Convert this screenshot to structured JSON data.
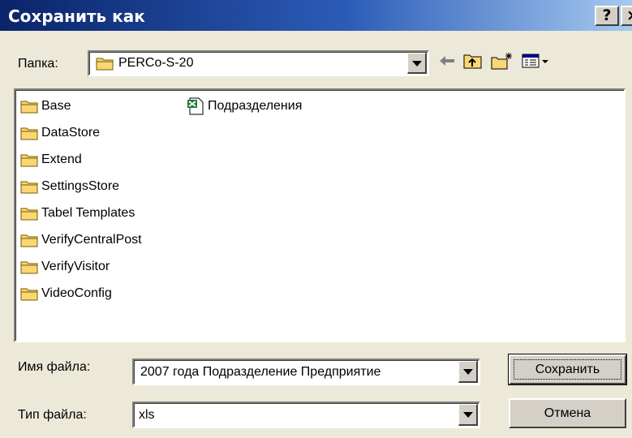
{
  "window": {
    "title": "Сохранить как",
    "help_label": "?",
    "close_label": "×"
  },
  "folder": {
    "label": "Папка:",
    "current": "PERCo-S-20"
  },
  "toolbar": {
    "back_icon": "back-arrow-icon",
    "up_icon": "up-folder-icon",
    "new_folder_icon": "new-folder-icon",
    "view_menu_icon": "view-menu-icon"
  },
  "files": {
    "folders": [
      "Base",
      "DataStore",
      "Extend",
      "SettingsStore",
      "Tabel Templates",
      "VerifyCentralPost",
      "VerifyVisitor",
      "VideoConfig"
    ],
    "documents": [
      "Подразделения"
    ]
  },
  "filename": {
    "label": "Имя файла:",
    "value": "2007 года  Подразделение Предприятие"
  },
  "filetype": {
    "label": "Тип файла:",
    "value": "xls"
  },
  "buttons": {
    "save": "Сохранить",
    "cancel": "Отмена"
  },
  "colors": {
    "titlebar_start": "#0a246a",
    "titlebar_end": "#a6caf0",
    "dialog_bg": "#ece9d8",
    "folder_icon": "#f8d775"
  }
}
